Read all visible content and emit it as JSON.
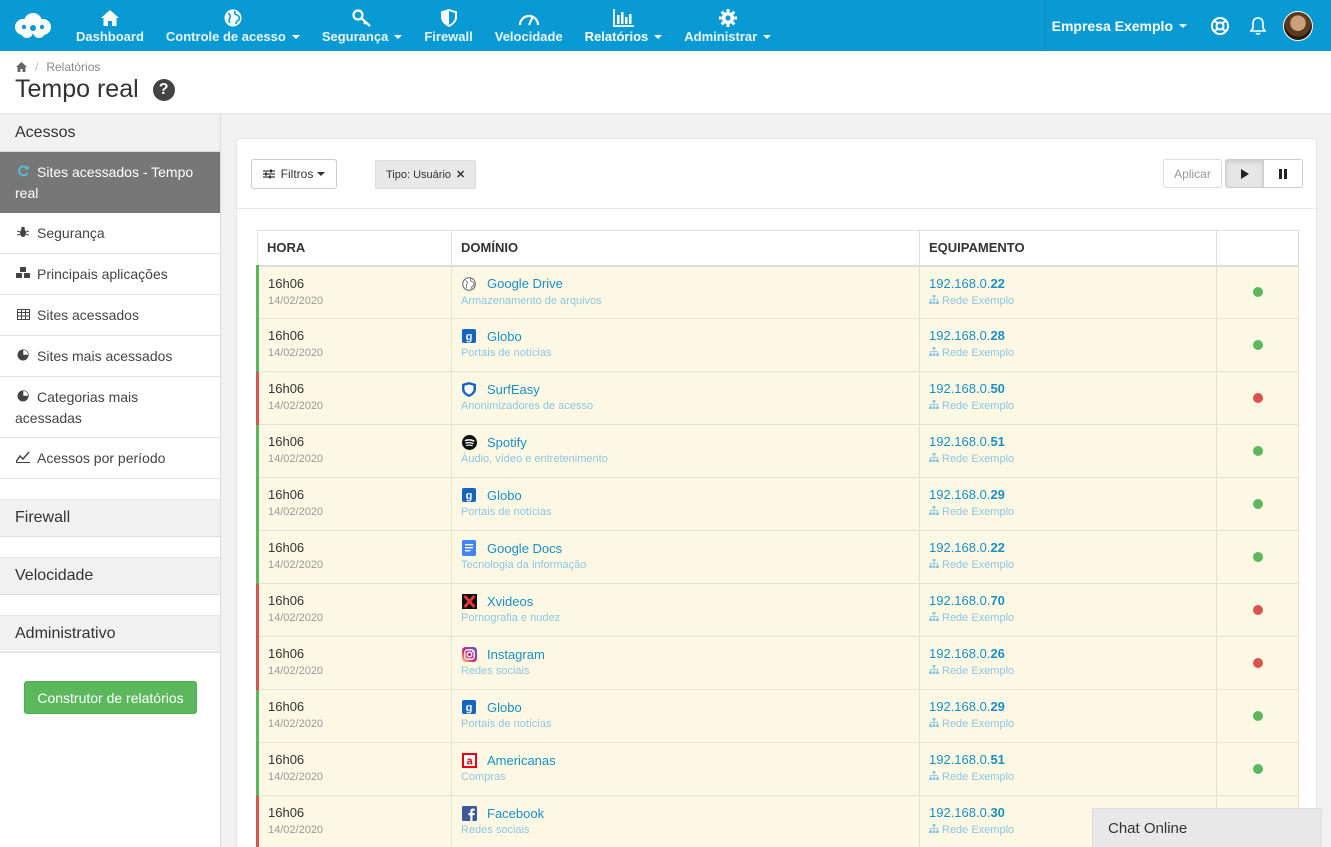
{
  "nav": {
    "items": [
      {
        "label": "Dashboard",
        "icon": "home-icon",
        "caret": false
      },
      {
        "label": "Controle de acesso",
        "icon": "globe-icon",
        "caret": true
      },
      {
        "label": "Segurança",
        "icon": "key-icon",
        "caret": true
      },
      {
        "label": "Firewall",
        "icon": "shield-icon",
        "caret": false
      },
      {
        "label": "Velocidade",
        "icon": "speedometer-icon",
        "caret": false
      },
      {
        "label": "Relatórios",
        "icon": "bar-chart-icon",
        "caret": true,
        "active": true
      },
      {
        "label": "Administrar",
        "icon": "gear-icon",
        "caret": true
      }
    ],
    "company": "Empresa Exemplo",
    "brand_color": "#0a9ad3"
  },
  "header": {
    "breadcrumb": "Relatórios",
    "title": "Tempo real"
  },
  "sidebar": {
    "sections": [
      {
        "label": "Acessos"
      },
      {
        "label": "Firewall"
      },
      {
        "label": "Velocidade"
      },
      {
        "label": "Administrativo"
      }
    ],
    "items": [
      {
        "label": "Sites acessados - Tempo real",
        "icon": "refresh-icon",
        "active": true
      },
      {
        "label": "Segurança",
        "icon": "bug-icon"
      },
      {
        "label": "Principais aplicações",
        "icon": "cubes-icon"
      },
      {
        "label": "Sites acessados",
        "icon": "table-icon"
      },
      {
        "label": "Sites mais acessados",
        "icon": "pie-chart-icon"
      },
      {
        "label": "Categorias mais acessadas",
        "icon": "pie-chart-icon"
      },
      {
        "label": "Acessos por período",
        "icon": "line-chart-icon"
      }
    ],
    "builder_button": "Construtor de relatórios"
  },
  "toolbar": {
    "filters_label": "Filtros",
    "chip_label": "Tipo: Usuário",
    "apply_label": "Aplicar"
  },
  "table": {
    "headers": [
      "HORA",
      "DOMÍNIO",
      "EQUIPAMENTO",
      ""
    ],
    "rows": [
      {
        "time": "16h06",
        "date": "14/02/2020",
        "domain": "Google Drive",
        "category": "Armazenamento de arquivos",
        "icon": "globe-icon",
        "ip_prefix": "192.168.0.",
        "ip_suffix": "22",
        "network": "Rede Exemplo",
        "status": "ok"
      },
      {
        "time": "16h06",
        "date": "14/02/2020",
        "domain": "Globo",
        "category": "Portais de notícias",
        "icon": "globo-icon",
        "ip_prefix": "192.168.0.",
        "ip_suffix": "28",
        "network": "Rede Exemplo",
        "status": "ok"
      },
      {
        "time": "16h06",
        "date": "14/02/2020",
        "domain": "SurfEasy",
        "category": "Anonimizadores de acesso",
        "icon": "surfeasy-icon",
        "ip_prefix": "192.168.0.",
        "ip_suffix": "50",
        "network": "Rede Exemplo",
        "status": "blocked"
      },
      {
        "time": "16h06",
        "date": "14/02/2020",
        "domain": "Spotify",
        "category": "Áudio, vídeo e entretenimento",
        "icon": "spotify-icon",
        "ip_prefix": "192.168.0.",
        "ip_suffix": "51",
        "network": "Rede Exemplo",
        "status": "ok"
      },
      {
        "time": "16h06",
        "date": "14/02/2020",
        "domain": "Globo",
        "category": "Portais de notícias",
        "icon": "globo-icon",
        "ip_prefix": "192.168.0.",
        "ip_suffix": "29",
        "network": "Rede Exemplo",
        "status": "ok"
      },
      {
        "time": "16h06",
        "date": "14/02/2020",
        "domain": "Google Docs",
        "category": "Tecnologia da informação",
        "icon": "google-docs-icon",
        "ip_prefix": "192.168.0.",
        "ip_suffix": "22",
        "network": "Rede Exemplo",
        "status": "ok"
      },
      {
        "time": "16h06",
        "date": "14/02/2020",
        "domain": "Xvideos",
        "category": "Pornografia e nudez",
        "icon": "xvideos-icon",
        "ip_prefix": "192.168.0.",
        "ip_suffix": "70",
        "network": "Rede Exemplo",
        "status": "blocked"
      },
      {
        "time": "16h06",
        "date": "14/02/2020",
        "domain": "Instagram",
        "category": "Redes sociais",
        "icon": "instagram-icon",
        "ip_prefix": "192.168.0.",
        "ip_suffix": "26",
        "network": "Rede Exemplo",
        "status": "blocked"
      },
      {
        "time": "16h06",
        "date": "14/02/2020",
        "domain": "Globo",
        "category": "Portais de notícias",
        "icon": "globo-icon",
        "ip_prefix": "192.168.0.",
        "ip_suffix": "29",
        "network": "Rede Exemplo",
        "status": "ok"
      },
      {
        "time": "16h06",
        "date": "14/02/2020",
        "domain": "Americanas",
        "category": "Compras",
        "icon": "americanas-icon",
        "ip_prefix": "192.168.0.",
        "ip_suffix": "51",
        "network": "Rede Exemplo",
        "status": "ok"
      },
      {
        "time": "16h06",
        "date": "14/02/2020",
        "domain": "Facebook",
        "category": "Redes sociais",
        "icon": "facebook-icon",
        "ip_prefix": "192.168.0.",
        "ip_suffix": "30",
        "network": "Rede Exemplo",
        "status": "blocked"
      }
    ]
  },
  "chat": {
    "label": "Chat Online"
  },
  "colors": {
    "ok": "#5cb85c",
    "blocked": "#d9534f",
    "row_bg": "#fcf8e3",
    "link": "#1a8fc7"
  }
}
